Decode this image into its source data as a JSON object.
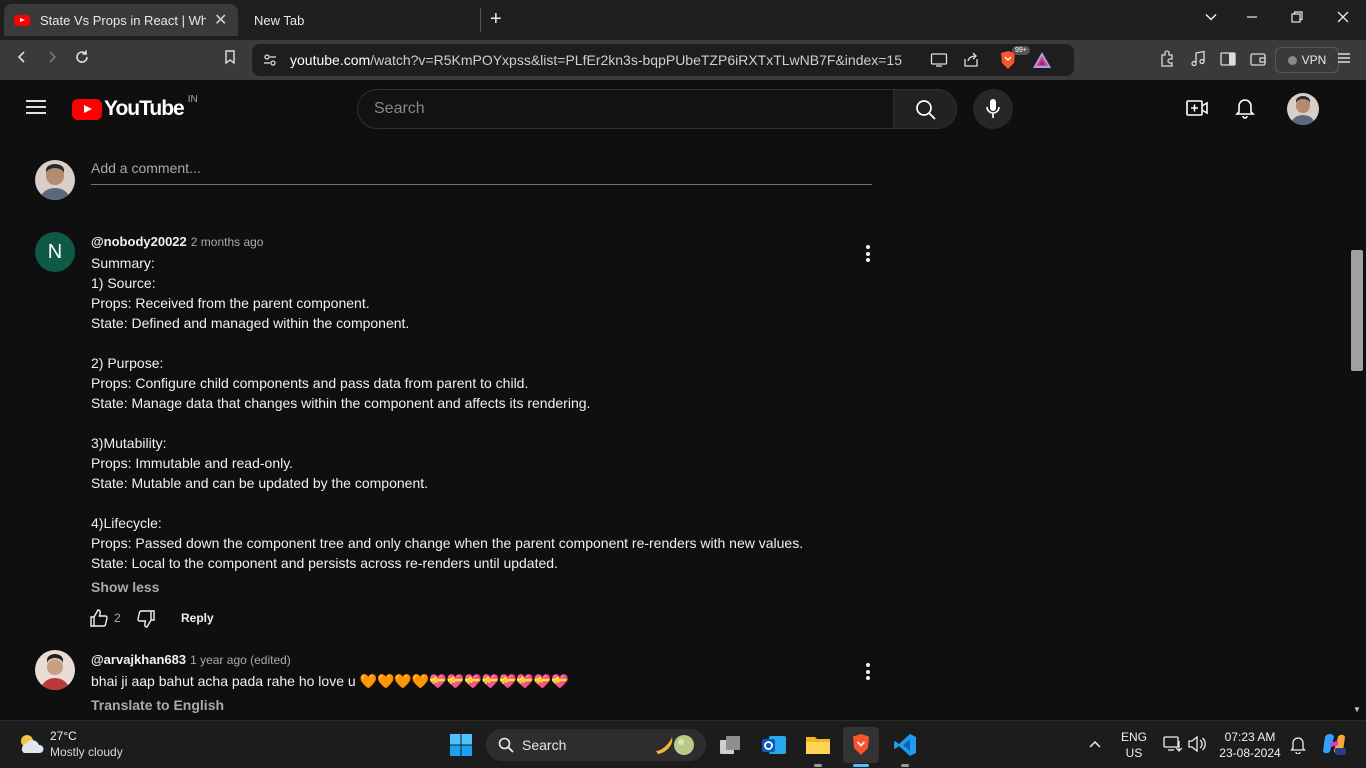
{
  "browser": {
    "tabs": [
      {
        "title": "State Vs Props in React | When to",
        "close": "✕"
      },
      {
        "title": "New Tab"
      }
    ],
    "new_tab": "+",
    "url_host": "youtube.com",
    "url_path": "/watch?v=R5KmPOYxpss&list=PLfEr2kn3s-bqpPUbeTZP6iRXTxTLwNB7F&index=15",
    "shield_badge": "99+",
    "vpn_label": "VPN"
  },
  "youtube": {
    "logo_text": "YouTube",
    "region": "IN",
    "search_placeholder": "Search"
  },
  "add_comment_placeholder": "Add a comment...",
  "comments": [
    {
      "initial": "N",
      "author": "@nobody20022",
      "time": "2 months ago",
      "body": "Summary:\n1) Source:\nProps: Received from the parent component.\nState: Defined and managed within the component.\n\n2) Purpose:\nProps: Configure child components and pass data from parent to child.\nState: Manage data that changes within the component and affects its rendering.\n\n3)Mutability:\nProps: Immutable and read-only.\nState: Mutable and can be updated by the component.\n\n4)Lifecycle:\nProps: Passed down the component tree and only change when the parent component re-renders with new values.\nState: Local to the component and persists across re-renders until updated.",
      "toggle": "Show less",
      "likes": "2",
      "reply": "Reply"
    },
    {
      "author": "@arvajkhan683",
      "time": "1 year ago (edited)",
      "body": "bhai ji aap bahut acha pada rahe ho love u 🧡🧡🧡🧡💝💝💝💝💝💝💝💝",
      "translate": "Translate to English"
    }
  ],
  "taskbar": {
    "weather_temp": "27°C",
    "weather_desc": "Mostly cloudy",
    "search_label": "Search",
    "lang_line1": "ENG",
    "lang_line2": "US",
    "time": "07:23 AM",
    "date": "23-08-2024"
  }
}
